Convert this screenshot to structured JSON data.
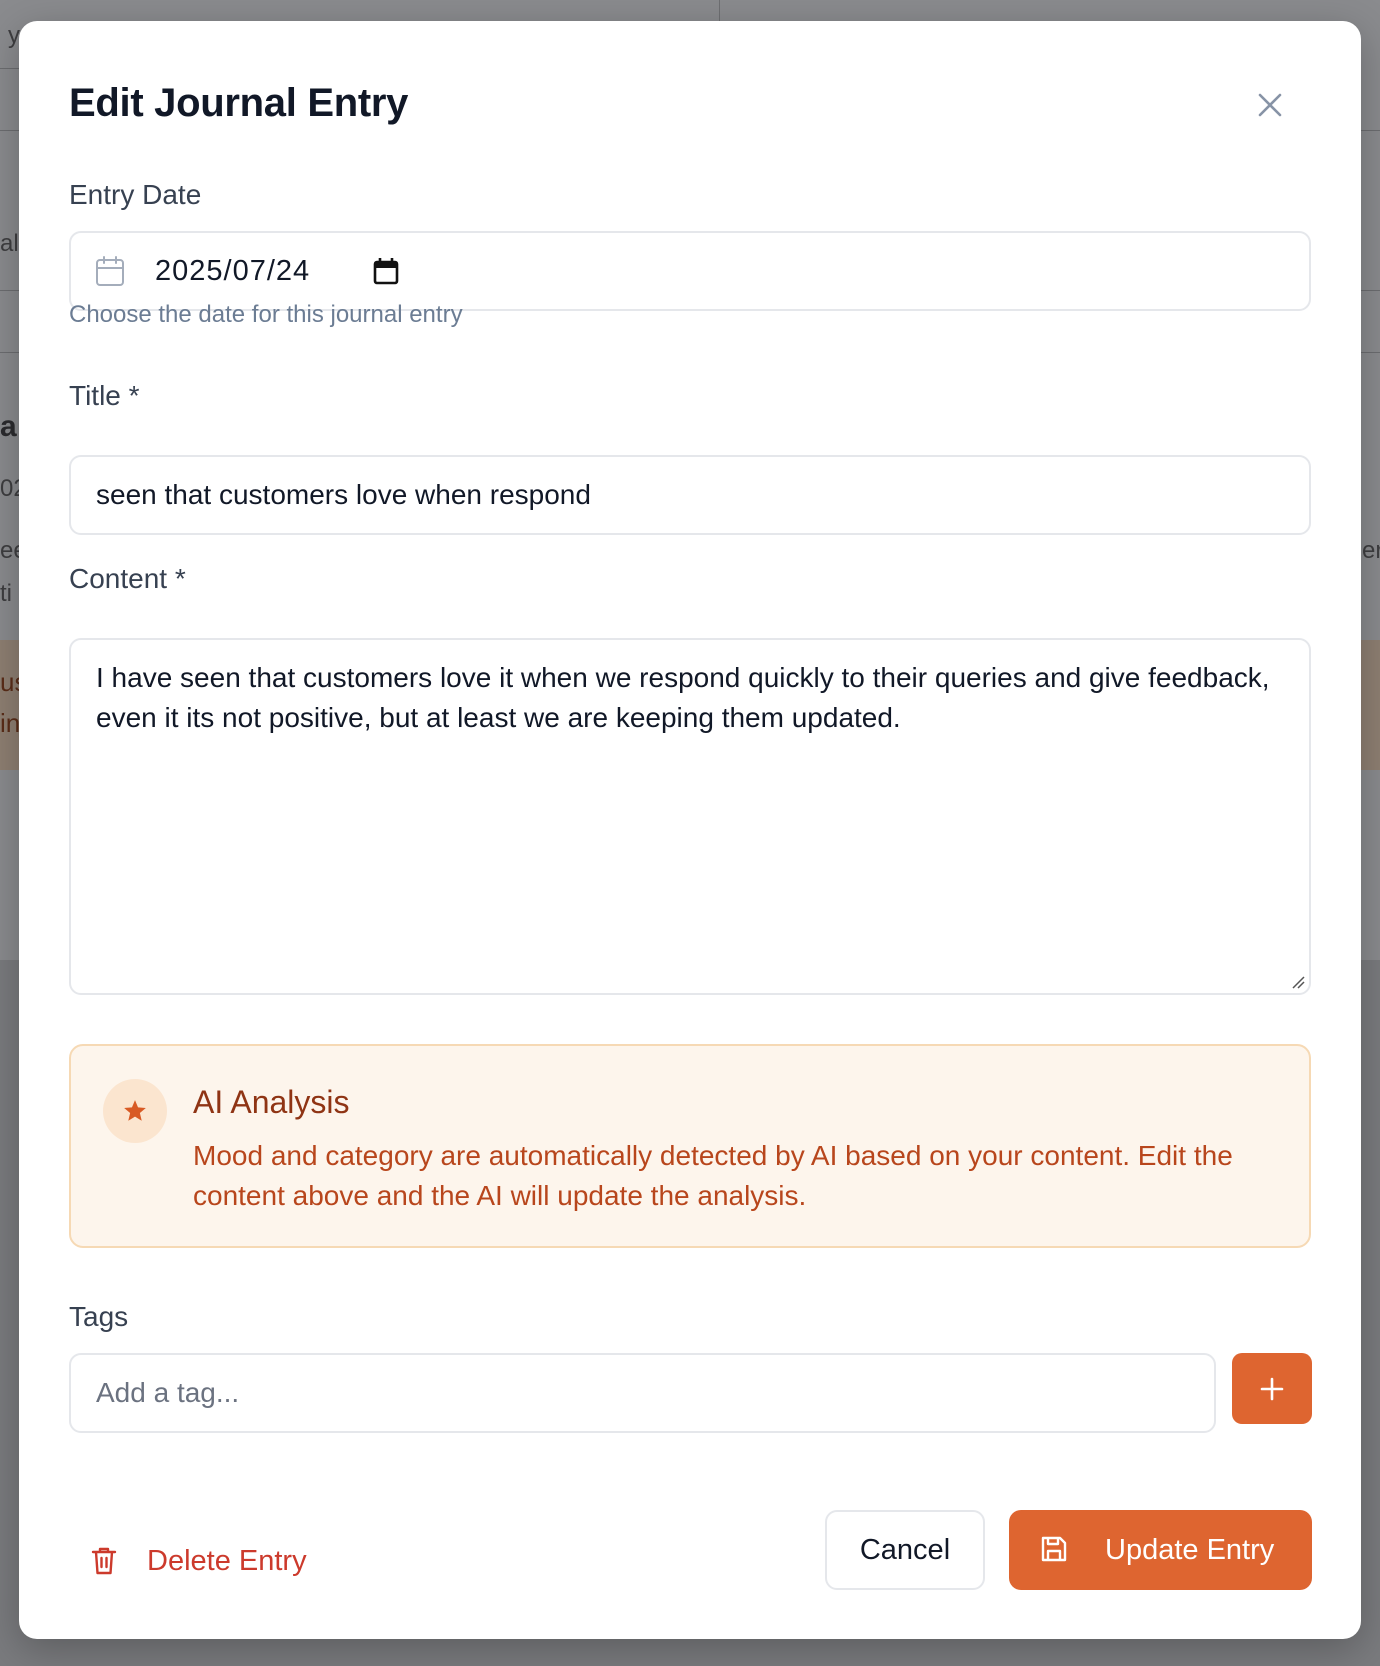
{
  "background": {
    "fragments": [
      "y",
      "al",
      "a",
      "02",
      "ee",
      "ti",
      "us",
      "in",
      "er"
    ]
  },
  "modal": {
    "title": "Edit Journal Entry",
    "close_icon": "close-icon"
  },
  "entry_date": {
    "label": "Entry Date",
    "value": "2025/07/24",
    "helper": "Choose the date for this journal entry",
    "icon": "calendar-icon"
  },
  "title_field": {
    "label": "Title *",
    "value": "seen that customers love when respond"
  },
  "content_field": {
    "label": "Content *",
    "value": "I have seen that customers love it when we respond quickly to their queries and give feedback, even it its not positive, but at least we are keeping them updated."
  },
  "ai_analysis": {
    "title": "AI Analysis",
    "description": "Mood and category are automatically detected by AI based on your content. Edit the content above and the AI will update the analysis.",
    "icon": "star-icon"
  },
  "tags": {
    "label": "Tags",
    "placeholder": "Add a tag...",
    "add_icon": "plus-icon"
  },
  "actions": {
    "delete_label": "Delete Entry",
    "cancel_label": "Cancel",
    "update_label": "Update Entry"
  },
  "colors": {
    "accent": "#de6530",
    "danger": "#cc3a2c",
    "ai_background": "#fdf5ec",
    "ai_text": "#b8461c"
  }
}
